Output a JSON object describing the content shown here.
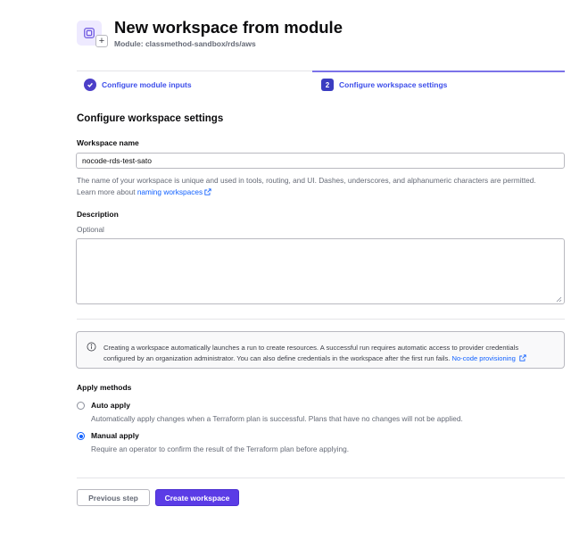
{
  "header": {
    "title": "New workspace from module",
    "subtitle": "Module: classmethod-sandbox/rds/aws",
    "badge": "+"
  },
  "steps": [
    {
      "label": "Configure module inputs",
      "state": "complete"
    },
    {
      "label": "Configure workspace settings",
      "number": "2",
      "state": "active"
    }
  ],
  "section_title": "Configure workspace settings",
  "workspace_name": {
    "label": "Workspace name",
    "value": "nocode-rds-test-sato",
    "helper_line1": "The name of your workspace is unique and used in tools, routing, and UI. Dashes, underscores, and alphanumeric characters are permitted.",
    "helper_prefix": "Learn more about ",
    "helper_link": "naming workspaces"
  },
  "description": {
    "label": "Description",
    "hint": "Optional",
    "value": ""
  },
  "alert": {
    "line1": "Creating a workspace automatically launches a run to create resources. A successful run requires automatic access to provider credentials",
    "line2": "configured by an organization administrator. You can also define credentials in the workspace after the first run fails. ",
    "link": "No-code provisioning"
  },
  "apply_methods": {
    "title": "Apply methods",
    "options": [
      {
        "label": "Auto apply",
        "description": "Automatically apply changes when a Terraform plan is successful. Plans that have no changes will not be applied.",
        "checked": false
      },
      {
        "label": "Manual apply",
        "description": "Require an operator to confirm the result of the Terraform plan before applying.",
        "checked": true
      }
    ]
  },
  "buttons": {
    "previous": "Previous step",
    "create": "Create workspace"
  },
  "colors": {
    "accent": "#5b3ce6",
    "link": "#1060ff",
    "step_text": "#3d4eea"
  }
}
